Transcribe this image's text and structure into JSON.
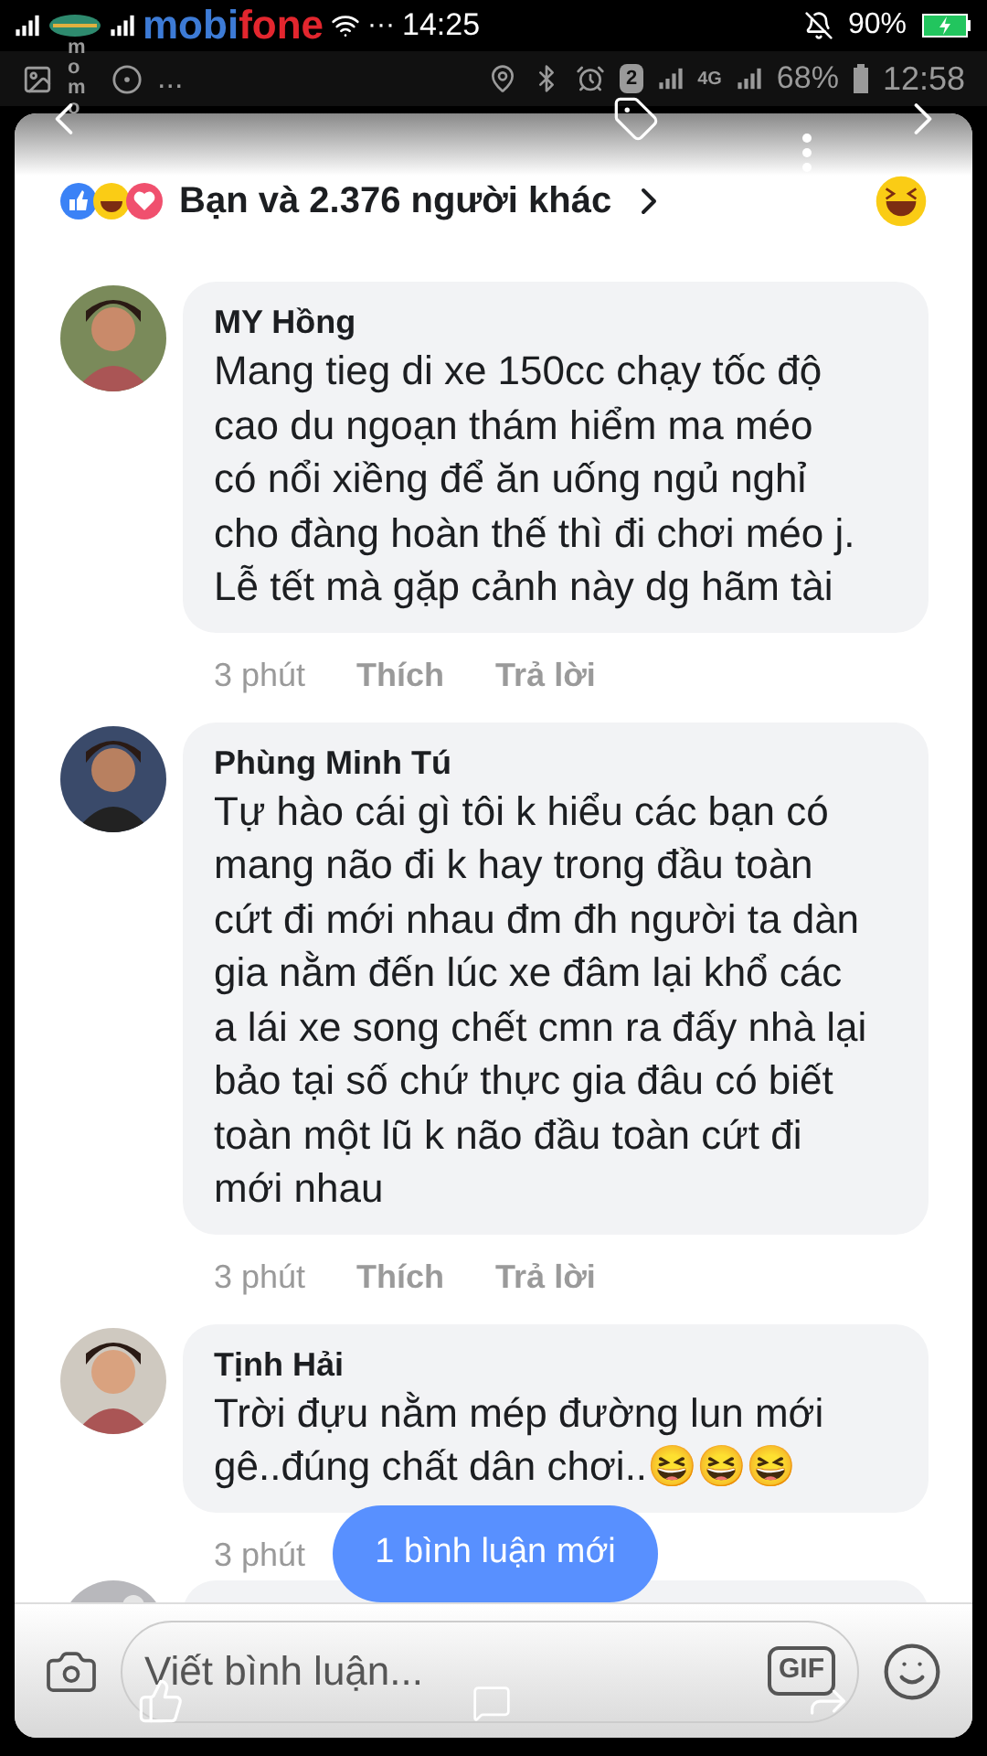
{
  "status_bar": {
    "carrier": "mobifone",
    "dots": "···",
    "time": "14:25",
    "battery": "90%"
  },
  "overlay_status_bar": {
    "app_label": "momo",
    "more": "...",
    "sim": "2",
    "network": "4G",
    "battery": "68%",
    "time": "12:58"
  },
  "reactions": {
    "summary": "Bạn và 2.376 người khác"
  },
  "comments": [
    {
      "author": "MY Hồng",
      "lines": [
        "Mang tieg di xe 150cc chạy tốc độ",
        "cao du ngoạn thám hiểm ma méo",
        "có nổi xiềng để ăn uống ngủ nghỉ",
        "cho đàng hoàn thế thì đi chơi méo j.",
        "Lễ tết mà gặp cảnh này dg hãm tài"
      ],
      "time": "3 phút",
      "like": "Thích",
      "reply": "Trả lời"
    },
    {
      "author": "Phùng Minh Tú",
      "lines": [
        "Tự hào cái gì tôi k hiểu các bạn có",
        "mang não đi k hay trong đầu toàn",
        "cứt đi mới nhau đm đh người ta dàn",
        "gia nằm đến lúc xe đâm lại khổ các",
        "a lái xe song chết cmn ra đấy nhà lại",
        "bảo tại số chứ thực gia đâu có biết",
        "toàn một lũ k não đầu toàn cứt đi",
        "mới nhau"
      ],
      "time": "3 phút",
      "like": "Thích",
      "reply": "Trả lời"
    },
    {
      "author": "Tịnh Hải",
      "lines": [
        "Trời đựu nằm mép đường lun mới",
        "gê..đúng chất dân chơi..😆😆😆"
      ],
      "time": "3 phút"
    }
  ],
  "new_comments_pill": "1 bình luận mới",
  "composer": {
    "placeholder": "Viết bình luận...",
    "gif": "GIF"
  }
}
